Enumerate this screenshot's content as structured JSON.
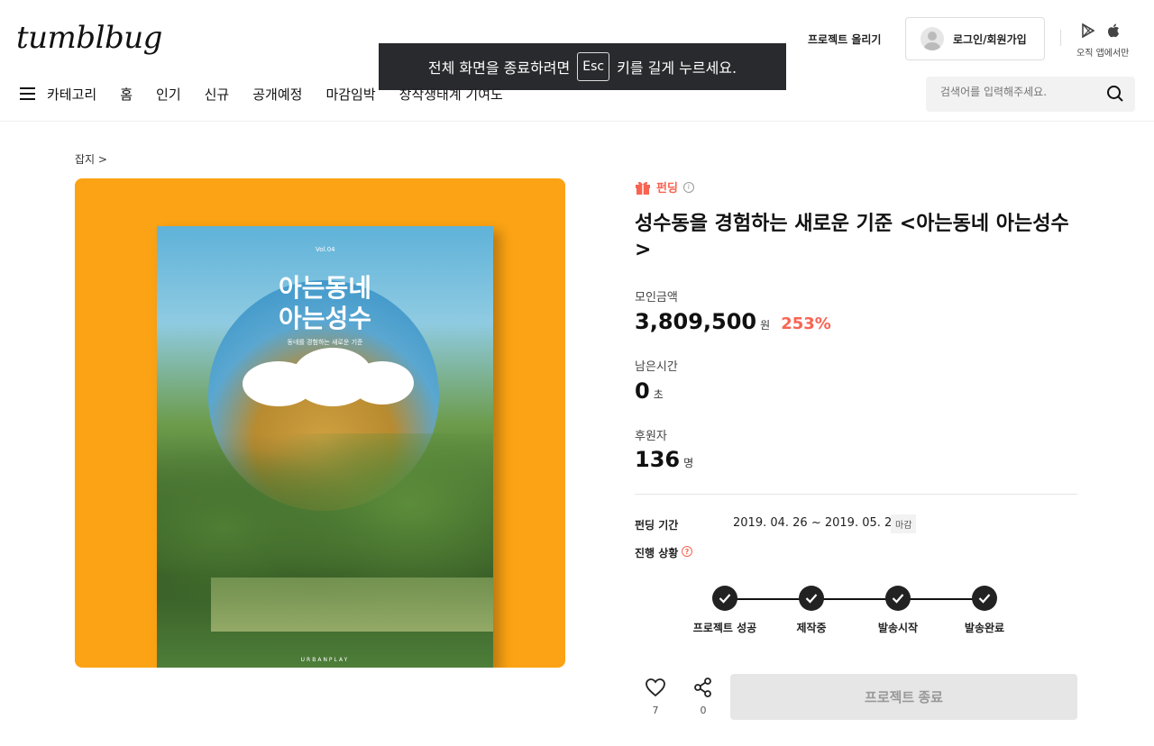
{
  "header": {
    "logo": "tumblbug",
    "upload_link": "프로젝트 올리기",
    "login_label": "로그인/회원가입",
    "app_label": "오직 앱에서만"
  },
  "nav": {
    "category": "카테고리",
    "items": [
      "홈",
      "인기",
      "신규",
      "공개예정",
      "마감임박",
      "창작생태계 기여도"
    ]
  },
  "search": {
    "placeholder": "검색어를 입력해주세요."
  },
  "fullscreen_toast": {
    "prefix": "전체 화면을 종료하려면",
    "key": "Esc",
    "suffix": "키를 길게 누르세요."
  },
  "breadcrumb": "잡지 >",
  "hero": {
    "book_vol": "Vol.04",
    "book_title_line1": "아는동네",
    "book_title_line2": "아는성수",
    "book_subtitle": "동네를 경험하는 새로운 기준",
    "book_footer": "URBANPLAY"
  },
  "project": {
    "tag": "펀딩",
    "title": "성수동을 경험하는 새로운 기준 <아는동네 아는성수>",
    "amount_label": "모인금액",
    "amount": "3,809,500",
    "amount_unit": "원",
    "percent": "253%",
    "time_label": "남은시간",
    "time": "0",
    "time_unit": "초",
    "backers_label": "후원자",
    "backers": "136",
    "backers_unit": "명",
    "period_label": "펀딩 기간",
    "period": "2019. 04. 26 ~ 2019. 05. 21",
    "period_badge": "마감",
    "status_label": "진행 상황",
    "steps": [
      "프로젝트 성공",
      "제작중",
      "발송시작",
      "발송완료"
    ],
    "like_count": "7",
    "share_count": "0",
    "end_button": "프로젝트 종료"
  },
  "colors": {
    "accent": "#f86453",
    "hero_bg": "#fba314"
  }
}
